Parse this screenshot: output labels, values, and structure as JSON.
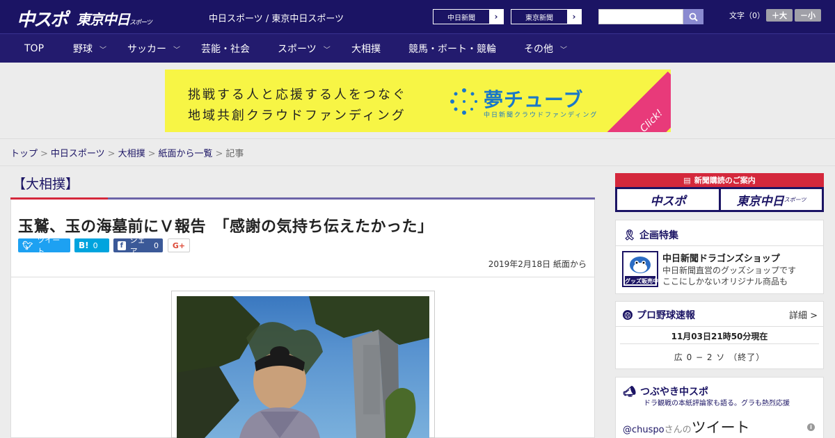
{
  "header": {
    "logo_main": "中スポ",
    "logo_tokyo": "東京中日",
    "logo_tokyo_small": "スポーツ",
    "sites_text": "中日スポーツ / 東京中日スポーツ",
    "site_buttons": [
      "中日新聞",
      "東京新聞"
    ],
    "search_placeholder": "",
    "font_size_label": "文字（0）",
    "font_plus": "＋大",
    "font_minus": "－小"
  },
  "nav": {
    "items": [
      {
        "label": "TOP",
        "has_menu": false
      },
      {
        "label": "野球",
        "has_menu": true
      },
      {
        "label": "サッカー",
        "has_menu": true
      },
      {
        "label": "芸能・社会",
        "has_menu": false
      },
      {
        "label": "スポーツ",
        "has_menu": true
      },
      {
        "label": "大相撲",
        "has_menu": false
      },
      {
        "label": "競馬・ボート・競輪",
        "has_menu": false
      },
      {
        "label": "その他",
        "has_menu": true
      }
    ]
  },
  "banner": {
    "line1": "挑戦する人と応援する人をつなぐ",
    "line2": "地域共創クラウドファンディング",
    "brand": "夢チューブ",
    "brand_sub": "中日新聞クラウドファンディング",
    "click": "Click!"
  },
  "breadcrumb": {
    "items": [
      "トップ",
      "中日スポーツ",
      "大相撲",
      "紙面から一覧"
    ],
    "current": "記事",
    "sep": ">"
  },
  "article": {
    "category": "【大相撲】",
    "headline": "玉鷲、玉の海墓前にＶ報告　「感謝の気持ち伝えたかった」",
    "share": {
      "tweet": "ツイート",
      "hatena_count": "0",
      "facebook": "シェア",
      "facebook_count": "0",
      "gplus": "G+"
    },
    "dateline": "2019年2月18日 紙面から"
  },
  "sidebar": {
    "subscribe_head": "新聞購読のご案内",
    "subscribe_buttons": [
      "中スポ",
      "東京中日"
    ],
    "subscribe_small": "スポーツ",
    "feature_title": "企画特集",
    "shop_name": "中日新聞ドラゴンズショップ",
    "shop_desc1": "中日新聞直営のグッズショップです",
    "shop_desc2": "ここにしかないオリジナル商品も",
    "shop_badge": "グッズ販売中",
    "baseball_title": "プロ野球速報",
    "baseball_detail": "詳細 >",
    "baseball_time": "11月03日21時50分現在",
    "baseball_score": "広 0 − 2 ソ （終了）",
    "tweet_title": "つぶやき中スポ",
    "tweet_sub": "ドラ観戦の本紙評論家も語る。グラも熱烈応援",
    "tweet_handle": "@chuspo",
    "tweet_san": "さんの",
    "tweet_big": "ツイート"
  },
  "colors": {
    "header_bg": "#1b1464",
    "accent_red": "#d4283c",
    "banner_yellow": "#f7f545",
    "twitter_blue": "#1da1f2",
    "hatena_blue": "#00a4de",
    "facebook_blue": "#3b5998"
  }
}
